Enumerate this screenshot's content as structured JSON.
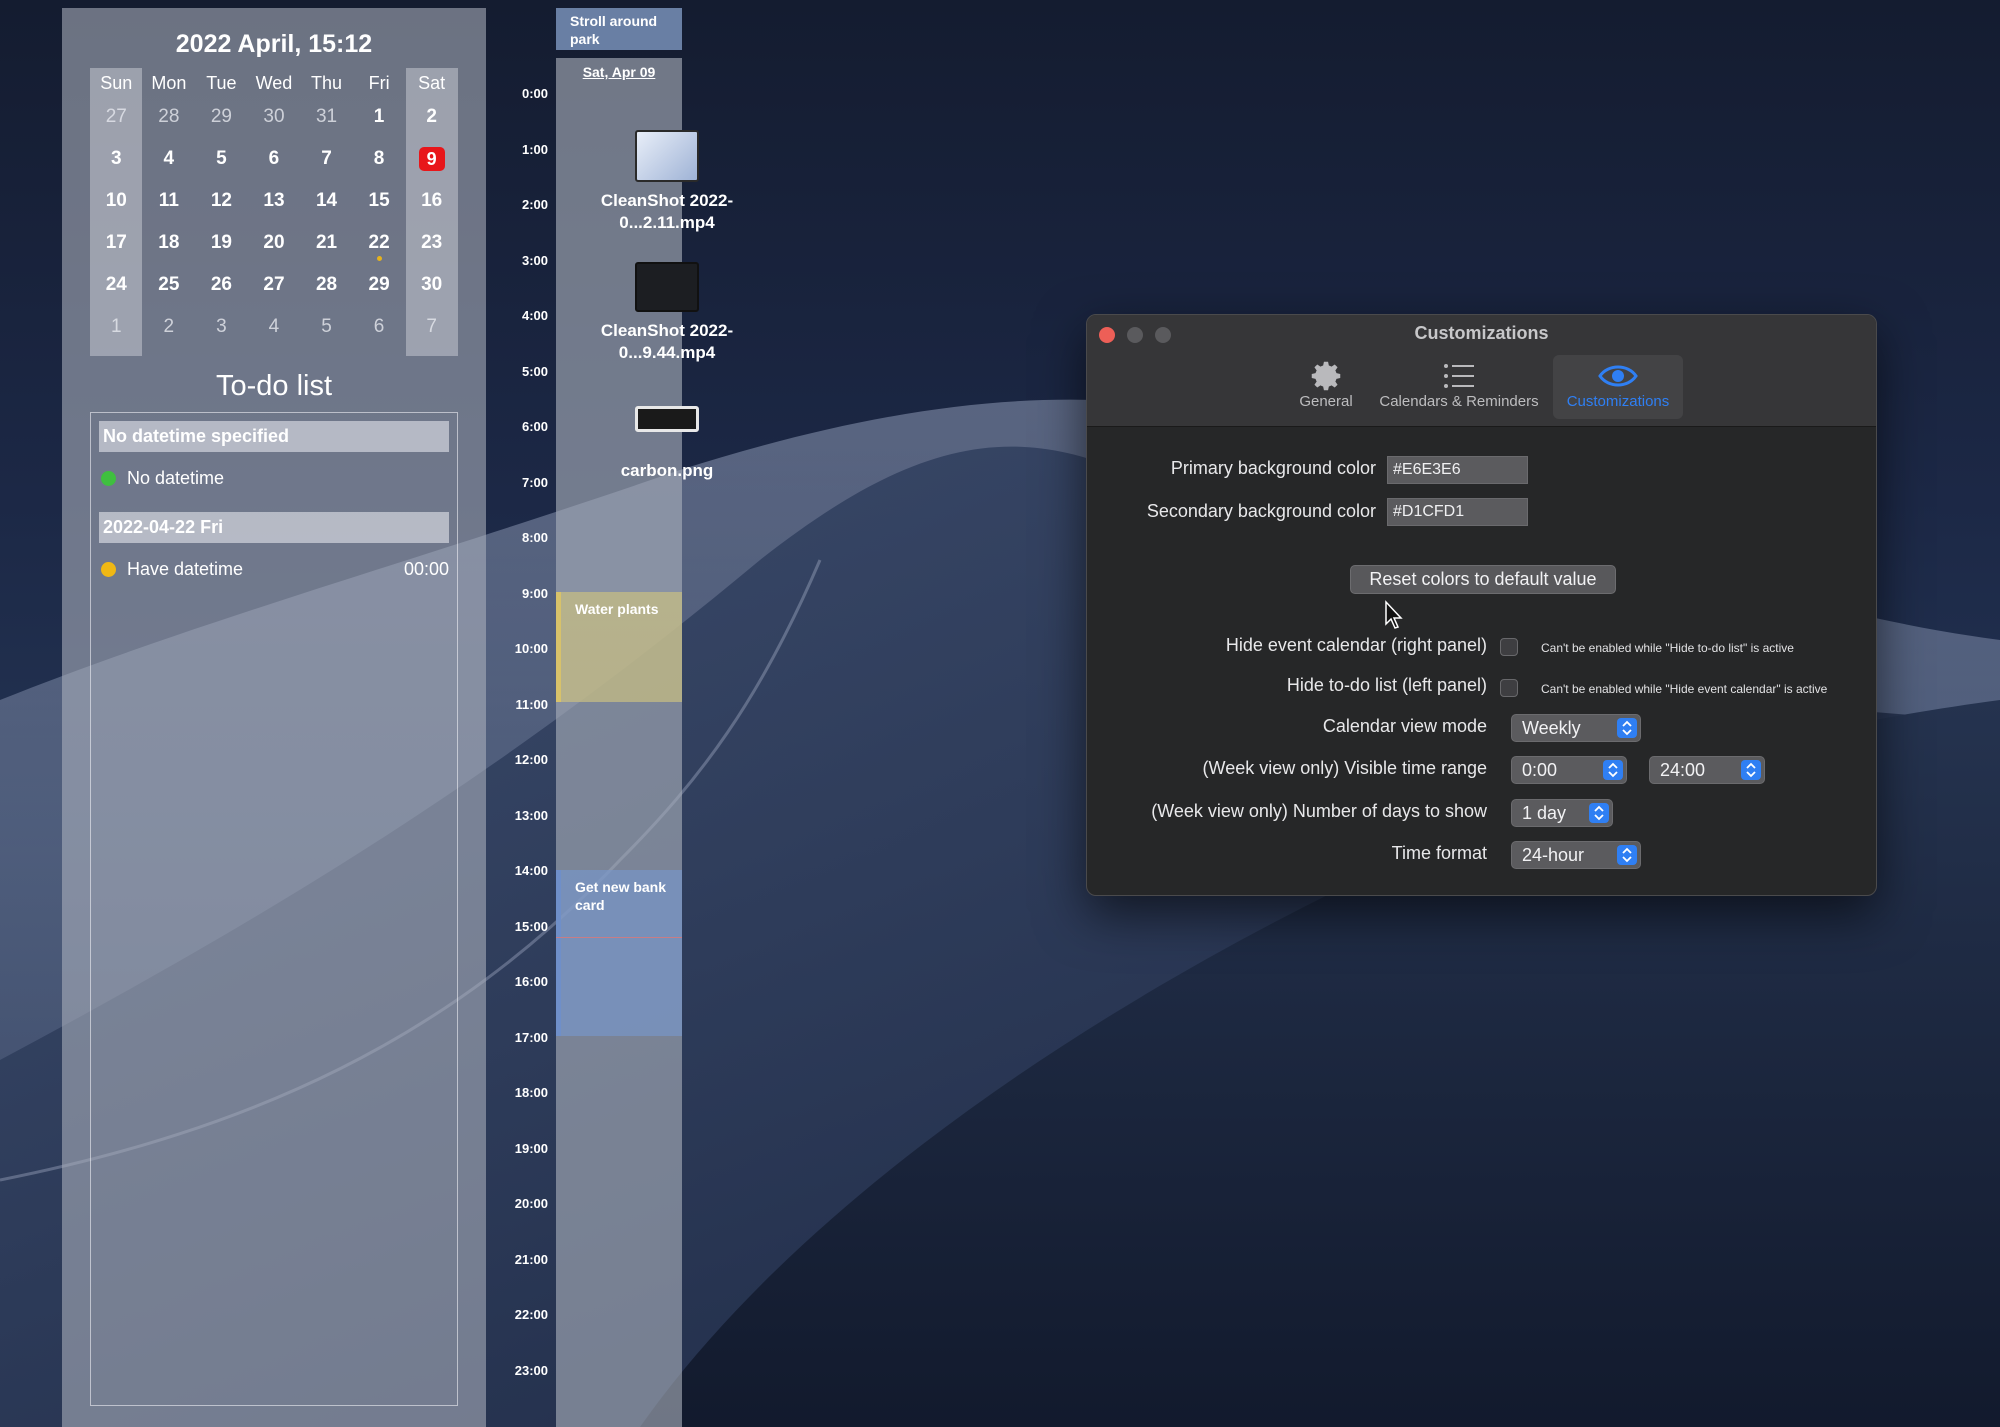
{
  "calendar": {
    "title": "2022 April, 15:12",
    "weekdays": [
      "Sun",
      "Mon",
      "Tue",
      "Wed",
      "Thu",
      "Fri",
      "Sat"
    ],
    "weeks": [
      [
        "27",
        "28",
        "29",
        "30",
        "31",
        "1",
        "2"
      ],
      [
        "3",
        "4",
        "5",
        "6",
        "7",
        "8",
        "9"
      ],
      [
        "10",
        "11",
        "12",
        "13",
        "14",
        "15",
        "16"
      ],
      [
        "17",
        "18",
        "19",
        "20",
        "21",
        "22",
        "23"
      ],
      [
        "24",
        "25",
        "26",
        "27",
        "28",
        "29",
        "30"
      ],
      [
        "1",
        "2",
        "3",
        "4",
        "5",
        "6",
        "7"
      ]
    ],
    "today": "9"
  },
  "todo": {
    "title": "To-do list",
    "sections": [
      {
        "header": "No datetime specified",
        "items": [
          {
            "label": "No datetime",
            "time": "",
            "color": "#3fbf3f"
          }
        ]
      },
      {
        "header": "2022-04-22 Fri",
        "items": [
          {
            "label": "Have datetime",
            "time": "00:00",
            "color": "#f0b814"
          }
        ]
      }
    ]
  },
  "day_view": {
    "all_day_event": "Stroll around park",
    "day_header": "Sat, Apr 09",
    "hours": [
      "0:00",
      "1:00",
      "2:00",
      "3:00",
      "4:00",
      "5:00",
      "6:00",
      "7:00",
      "8:00",
      "9:00",
      "10:00",
      "11:00",
      "12:00",
      "13:00",
      "14:00",
      "15:00",
      "16:00",
      "17:00",
      "18:00",
      "19:00",
      "20:00",
      "21:00",
      "22:00",
      "23:00"
    ],
    "events": [
      {
        "title": "Water plants",
        "color": "#d8c26a"
      },
      {
        "title": "Get new bank card",
        "color": "#6f8fc9"
      }
    ]
  },
  "desktop_files": [
    {
      "name": "CleanShot 2022-0...2.11.mp4"
    },
    {
      "name": "CleanShot 2022-0...9.44.mp4"
    },
    {
      "name": "carbon.png"
    }
  ],
  "prefs": {
    "window_title": "Customizations",
    "tabs": [
      {
        "label": "General",
        "icon": "gear-icon"
      },
      {
        "label": "Calendars & Reminders",
        "icon": "list-icon"
      },
      {
        "label": "Customizations",
        "icon": "eye-icon",
        "active": true
      }
    ],
    "primary_bg_label": "Primary background color",
    "primary_bg_value": "#E6E3E6",
    "secondary_bg_label": "Secondary background color",
    "secondary_bg_value": "#D1CFD1",
    "reset_label": "Reset colors to default value",
    "hide_event_label": "Hide event calendar (right panel)",
    "hide_event_hint": "Can't be enabled while \"Hide to-do list\" is active",
    "hide_todo_label": "Hide to-do list (left panel)",
    "hide_todo_hint": "Can't be enabled while \"Hide event calendar\" is active",
    "view_mode_label": "Calendar view mode",
    "view_mode_value": "Weekly",
    "time_range_label": "(Week view only) Visible time range",
    "time_range_start": "0:00",
    "time_range_end": "24:00",
    "days_label": "(Week view only) Number of days to show",
    "days_value": "1 day",
    "time_format_label": "Time format",
    "time_format_value": "24-hour",
    "accent_color": "#2f7ff3"
  }
}
